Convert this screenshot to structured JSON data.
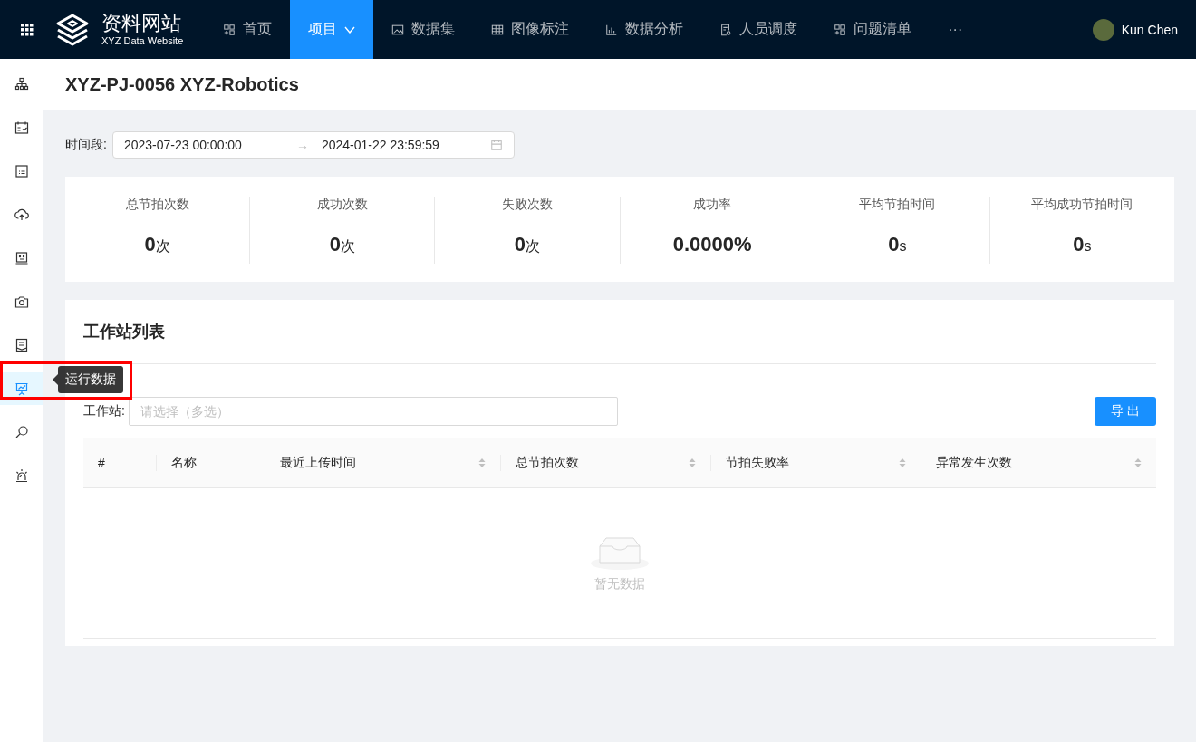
{
  "header": {
    "logo_title": "资料网站",
    "logo_subtitle": "XYZ Data Website",
    "nav": [
      {
        "label": "首页",
        "selected": false
      },
      {
        "label": "项目",
        "selected": true
      },
      {
        "label": "数据集",
        "selected": false
      },
      {
        "label": "图像标注",
        "selected": false
      },
      {
        "label": "数据分析",
        "selected": false
      },
      {
        "label": "人员调度",
        "selected": false
      },
      {
        "label": "问题清单",
        "selected": false
      },
      {
        "label": "···",
        "selected": false
      }
    ],
    "user": "Kun Chen"
  },
  "sidebar": {
    "items": [
      {
        "selected": false
      },
      {
        "selected": false
      },
      {
        "selected": false
      },
      {
        "selected": false
      },
      {
        "selected": false
      },
      {
        "selected": false
      },
      {
        "selected": false
      },
      {
        "selected": true
      },
      {
        "selected": false
      },
      {
        "selected": false
      }
    ],
    "tooltip": "运行数据"
  },
  "page_title": "XYZ-PJ-0056 XYZ-Robotics",
  "filter": {
    "label": "时间段:",
    "start": "2023-07-23 00:00:00",
    "separator": "→",
    "end": "2024-01-22 23:59:59"
  },
  "stats": [
    {
      "label": "总节拍次数",
      "value": "0",
      "unit": "次"
    },
    {
      "label": "成功次数",
      "value": "0",
      "unit": "次"
    },
    {
      "label": "失败次数",
      "value": "0",
      "unit": "次"
    },
    {
      "label": "成功率",
      "value": "0.0000%"
    },
    {
      "label": "平均节拍时间",
      "value": "0",
      "unit": "s"
    },
    {
      "label": "平均成功节拍时间",
      "value": "0",
      "unit": "s"
    }
  ],
  "workstations": {
    "title": "工作站列表",
    "field_label": "工作站:",
    "placeholder": "请选择（多选）",
    "export_button": "导 出",
    "table": {
      "columns": [
        {
          "label": "#",
          "sortable": false
        },
        {
          "label": "名称",
          "sortable": false
        },
        {
          "label": "最近上传时间",
          "sortable": true
        },
        {
          "label": "总节拍次数",
          "sortable": true
        },
        {
          "label": "节拍失败率",
          "sortable": true
        },
        {
          "label": "异常发生次数",
          "sortable": true
        }
      ],
      "empty_text": "暂无数据"
    }
  }
}
